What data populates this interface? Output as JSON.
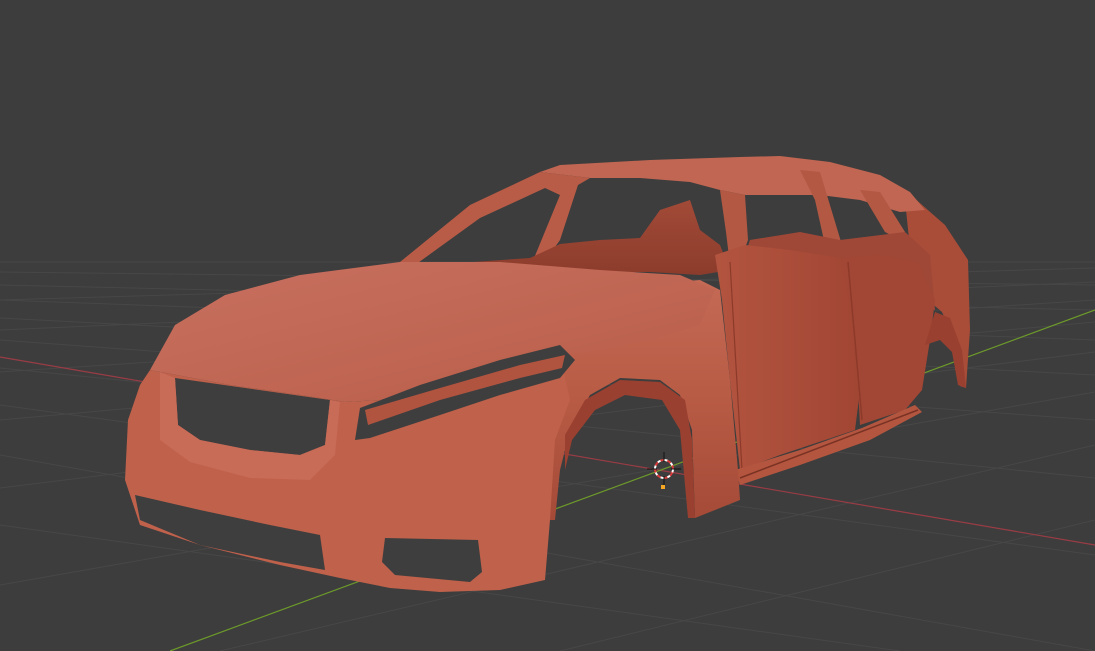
{
  "viewport": {
    "background_color": "#3d3d3d",
    "grid_color": "#474747",
    "x_axis_color": "#9a3c45",
    "y_axis_color": "#6d9a2a",
    "model_color": "#c0624c",
    "cursor_icon": "3d-cursor-icon",
    "origin_icon": "object-origin-icon"
  }
}
